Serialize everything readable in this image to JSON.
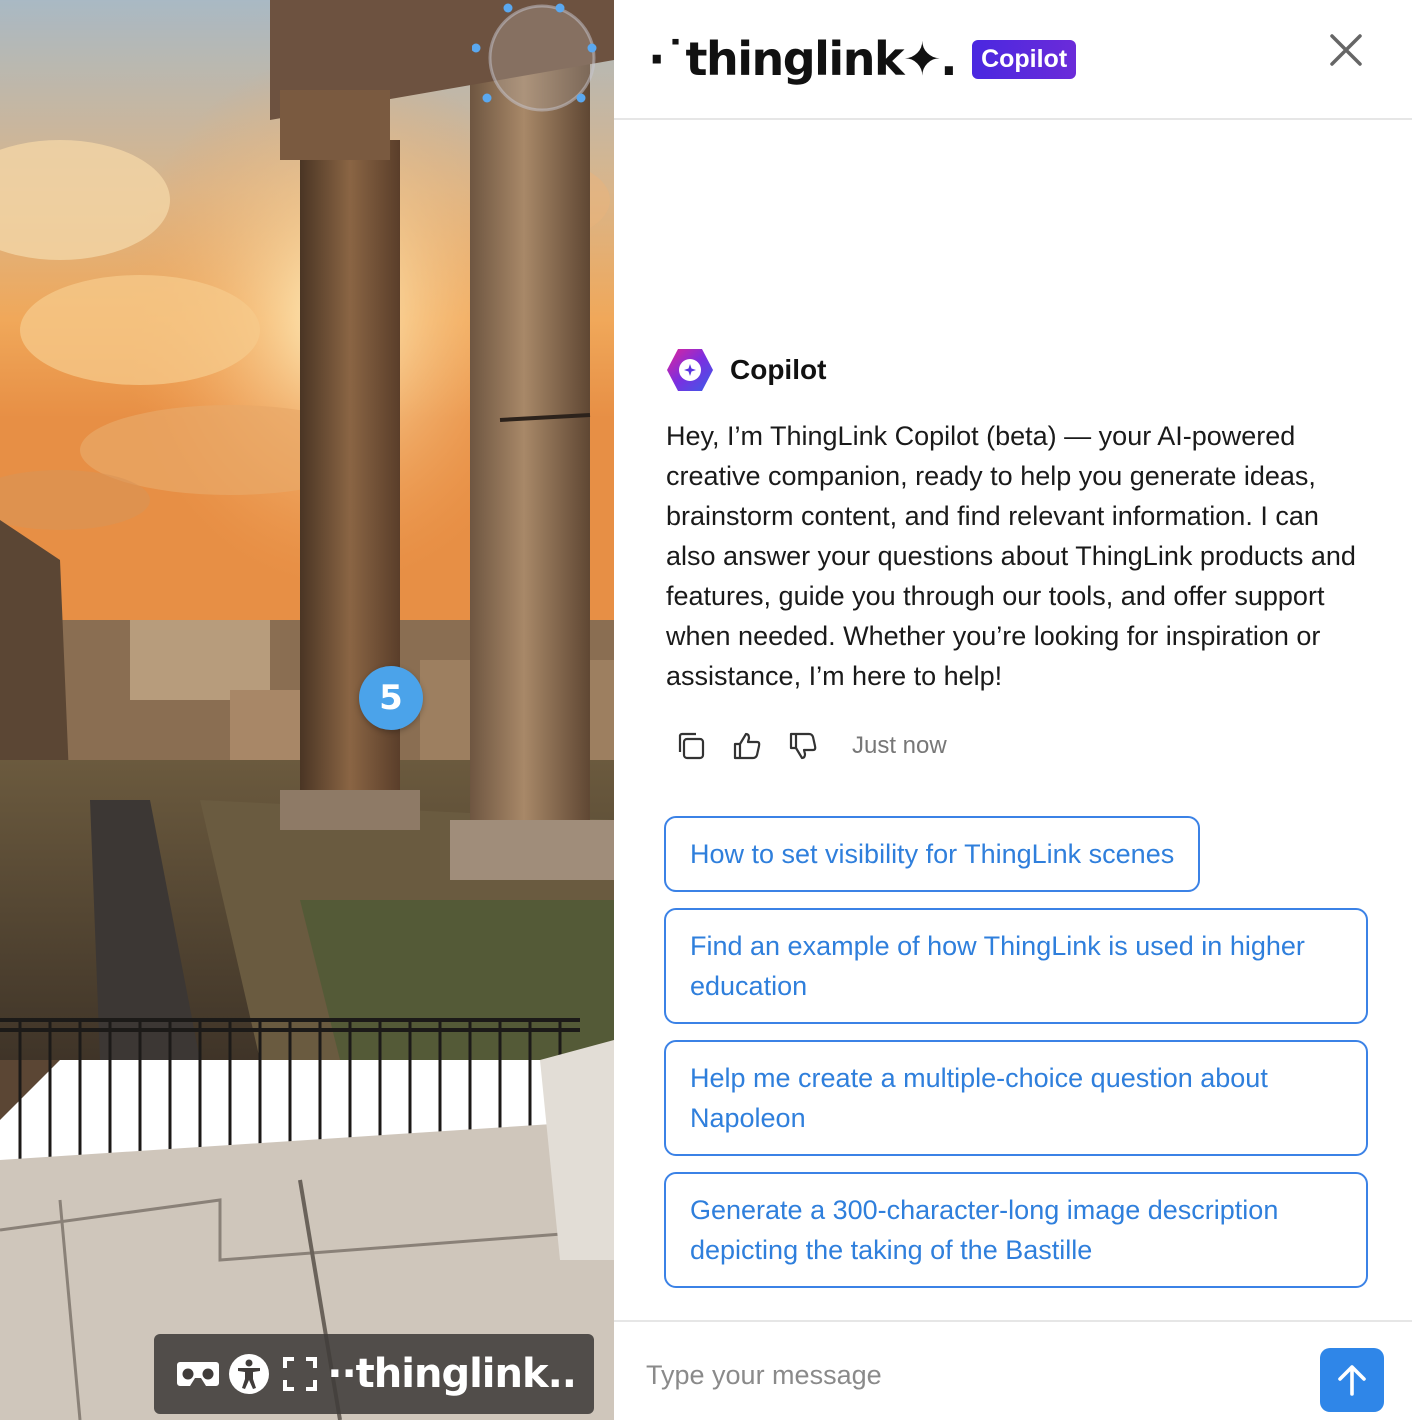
{
  "scene": {
    "hotspot_number": "5",
    "viewer_bar": {
      "logo_text": "··thinglink.."
    }
  },
  "panel": {
    "header": {
      "logo_text": "·˙thinglink✦.",
      "badge": "Copilot"
    },
    "message": {
      "author": "Copilot",
      "text": "Hey, I’m ThingLink Copilot (beta) — your AI-powered creative companion, ready to help you generate ideas, brainstorm content, and find relevant information. I can also answer your questions about ThingLink products and features, guide you through our tools, and offer support when needed. Whether you’re looking for inspiration or assistance, I’m here to help!",
      "timestamp": "Just now"
    },
    "suggestions": [
      "How to set visibility for ThingLink scenes",
      "Find an example of how ThingLink is used in higher education",
      "Help me create a multiple-choice question about Napoleon",
      "Generate a 300-character-long image description depicting the taking of the Bastille"
    ],
    "composer": {
      "placeholder": "Type your message"
    }
  },
  "colors": {
    "accent": "#3b82e6",
    "badge_gradient_start": "#4a28e0",
    "badge_gradient_end": "#6b2bd9",
    "hotspot": "#4ba3ea",
    "send_button": "#2f86e8"
  },
  "icons": [
    "vr-headset-icon",
    "accessibility-icon",
    "fullscreen-icon",
    "close-icon",
    "copilot-hexagon-icon",
    "copy-icon",
    "thumbs-up-icon",
    "thumbs-down-icon",
    "send-arrow-icon"
  ]
}
